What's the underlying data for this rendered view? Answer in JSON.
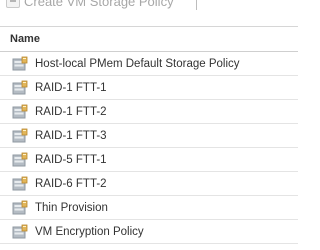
{
  "toolbar": {
    "create_label": "Create VM Storage Policy"
  },
  "grid": {
    "column_name": "Name",
    "rows": [
      {
        "name": "Host-local PMem Default Storage Policy",
        "icon": "storage-policy-icon"
      },
      {
        "name": "RAID-1 FTT-1",
        "icon": "storage-policy-icon"
      },
      {
        "name": "RAID-1 FTT-2",
        "icon": "storage-policy-icon"
      },
      {
        "name": "RAID-1 FTT-3",
        "icon": "storage-policy-icon"
      },
      {
        "name": "RAID-5 FTT-1",
        "icon": "storage-policy-icon"
      },
      {
        "name": "RAID-6 FTT-2",
        "icon": "storage-policy-icon"
      },
      {
        "name": "Thin Provision",
        "icon": "storage-policy-icon"
      },
      {
        "name": "VM Encryption Policy",
        "icon": "storage-policy-icon"
      }
    ]
  },
  "colors": {
    "icon_base": "#b4bcc4",
    "icon_accent": "#e2b65a",
    "row_divider": "#e4e4e4"
  }
}
